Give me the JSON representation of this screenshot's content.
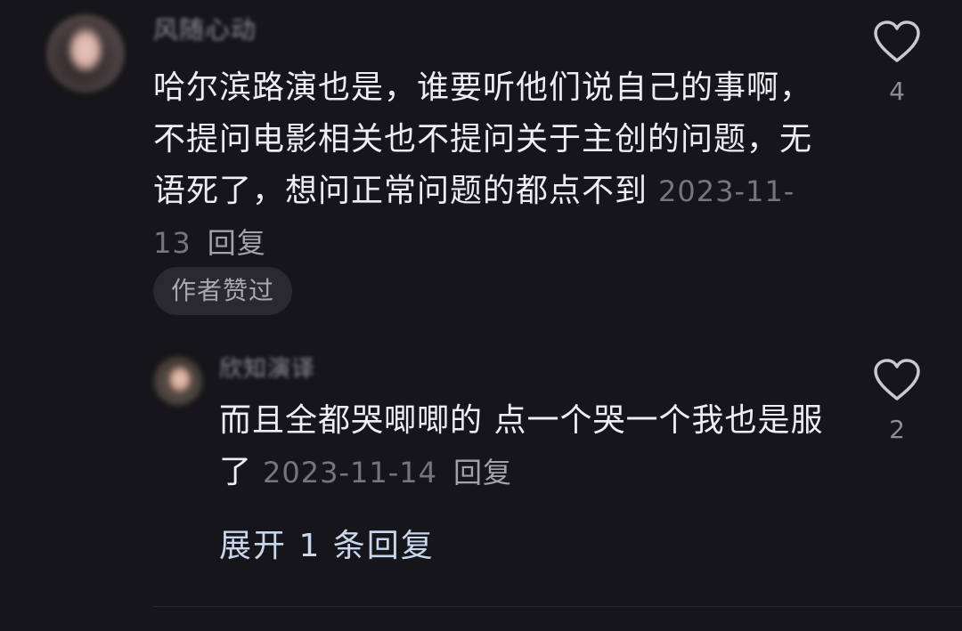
{
  "comment": {
    "username": "风随心动",
    "text": "哈尔滨路演也是，谁要听他们说自己的事啊，不提问电影相关也不提问关于主创的问题，无语死了，想问正常问题的都点不到",
    "date": "2023-11-13",
    "reply_label": "回复",
    "author_liked_label": "作者赞过",
    "like_count": "4"
  },
  "reply": {
    "username": "欣知演译",
    "text": "而且全都哭唧唧的 点一个哭一个我也是服了",
    "date": "2023-11-14",
    "reply_label": "回复",
    "like_count": "2"
  },
  "expand_replies_label": "展开 1 条回复",
  "icons": {
    "like": "heart-outline-icon"
  },
  "colors": {
    "background": "#161519",
    "text": "#eeedf2",
    "muted": "#76747e",
    "link": "#c8d6ee"
  }
}
